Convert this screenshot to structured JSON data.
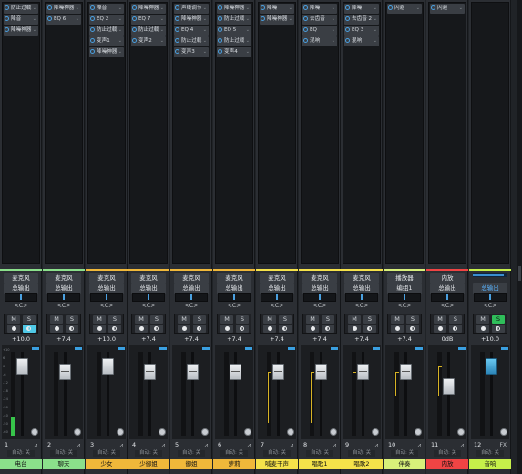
{
  "channels": [
    {
      "num": "1",
      "name": "电台",
      "color": "#8be08b",
      "inserts": [
        "防止过载",
        "降音",
        "降噪神器"
      ],
      "route1": "麦克风",
      "route2": "总输出",
      "pan": "<C>",
      "m": "M",
      "s": "S",
      "mon_on": true,
      "vol": "+10.0",
      "auto": "自动: 关",
      "level": 0.22,
      "fader": 0.92,
      "peak": true
    },
    {
      "num": "2",
      "name": "聊天",
      "color": "#8be08b",
      "inserts": [
        "降噪神器",
        "EQ 6"
      ],
      "route1": "麦克风",
      "route2": "总输出",
      "pan": "<C>",
      "m": "M",
      "s": "S",
      "mon_on": false,
      "vol": "+7.4",
      "auto": "自动: 关",
      "level": 0,
      "fader": 0.86,
      "peak": true
    },
    {
      "num": "3",
      "name": "少女",
      "color": "#f0b83a",
      "inserts": [
        "嗓音",
        "EQ 2",
        "防止过载",
        "变声1",
        "降噪神器"
      ],
      "route1": "麦克风",
      "route2": "总输出",
      "pan": "<C>",
      "m": "M",
      "s": "S",
      "mon_on": false,
      "vol": "+10.0",
      "auto": "自动: 关",
      "level": 0,
      "fader": 0.92,
      "peak": true
    },
    {
      "num": "4",
      "name": "少御姐",
      "color": "#f0b83a",
      "inserts": [
        "降噪神器",
        "EQ 7",
        "防止过载",
        "变声2"
      ],
      "route1": "麦克风",
      "route2": "总输出",
      "pan": "<C>",
      "m": "M",
      "s": "S",
      "mon_on": false,
      "vol": "+7.4",
      "auto": "自动: 关",
      "level": 0,
      "fader": 0.86,
      "peak": true
    },
    {
      "num": "5",
      "name": "御姐",
      "color": "#f0b83a",
      "inserts": [
        "声线调节",
        "降噪神器",
        "EQ 4",
        "防止过载",
        "变声3"
      ],
      "route1": "麦克风",
      "route2": "总输出",
      "pan": "<C>",
      "m": "M",
      "s": "S",
      "mon_on": false,
      "vol": "+7.4",
      "auto": "自动: 关",
      "level": 0,
      "fader": 0.86,
      "peak": true
    },
    {
      "num": "6",
      "name": "萝莉",
      "color": "#f0b83a",
      "inserts": [
        "降噪神器",
        "防止过载",
        "EQ 5",
        "防止过载",
        "变声4"
      ],
      "route1": "麦克风",
      "route2": "总输出",
      "pan": "<C>",
      "m": "M",
      "s": "S",
      "mon_on": false,
      "vol": "+7.4",
      "auto": "自动: 关",
      "level": 0,
      "fader": 0.86,
      "peak": true
    },
    {
      "num": "7",
      "name": "喊麦干声",
      "color": "#f5e24a",
      "inserts": [
        "降噪",
        "降噪神器"
      ],
      "route1": "麦克风",
      "route2": "总输出",
      "pan": "<C>",
      "m": "M",
      "s": "S",
      "mon_on": false,
      "vol": "+7.4",
      "auto": "自动: 关",
      "level": 0,
      "fader": 0.86,
      "peak": true,
      "yline": [
        30,
        86
      ]
    },
    {
      "num": "8",
      "name": "唱歌1",
      "color": "#f5e24a",
      "inserts": [
        "降噪",
        "去齿音",
        "EQ",
        "混响"
      ],
      "route1": "麦克风",
      "route2": "总输出",
      "pan": "<C>",
      "m": "M",
      "s": "S",
      "mon_on": false,
      "vol": "+7.4",
      "auto": "自动: 关",
      "level": 0,
      "fader": 0.86,
      "peak": true,
      "yline": [
        30,
        86
      ]
    },
    {
      "num": "9",
      "name": "唱歌2",
      "color": "#f5e24a",
      "inserts": [
        "降噪",
        "去齿音 2",
        "EQ 3",
        "混响"
      ],
      "route1": "麦克风",
      "route2": "总输出",
      "pan": "<C>",
      "m": "M",
      "s": "S",
      "mon_on": false,
      "vol": "+7.4",
      "auto": "自动: 关",
      "level": 0,
      "fader": 0.86,
      "peak": true,
      "yline": [
        30,
        86
      ]
    },
    {
      "num": "10",
      "name": "伴奏",
      "color": "#d8f07a",
      "inserts": [
        "闪避"
      ],
      "route1": "播放器",
      "route2": "编组1",
      "pan": "<C>",
      "m": "M",
      "s": "S",
      "mon_on": false,
      "vol": "+7.4",
      "auto": "自动: 关",
      "level": 0,
      "fader": 0.86,
      "peak": true,
      "yline": [
        30,
        56
      ]
    },
    {
      "num": "11",
      "name": "内放",
      "color": "#f04444",
      "inserts": [
        "闪避"
      ],
      "route1": "内放",
      "route2": "总输出",
      "pan": "<C>",
      "m": "M",
      "s": "S",
      "mon_on": false,
      "vol": "0dB",
      "auto": "自动: 关",
      "level": 0,
      "fader": 0.68,
      "peak": true,
      "yline": [
        24,
        56
      ]
    },
    {
      "num": "12",
      "name": "音响",
      "color": "#c6f04a",
      "inserts": [],
      "route1": "",
      "route2": "总输出",
      "pan": "<C>",
      "m": "M",
      "s": "S",
      "mon_on": false,
      "s_on": true,
      "vol": "+10.0",
      "auto": "自动: 关",
      "level": 0,
      "fader": 0.92,
      "peak": true,
      "fx": "FX",
      "blue": true
    }
  ],
  "scale": [
    "+10",
    "6",
    "0",
    "-6",
    "-12",
    "-18",
    "-24",
    "-30",
    "-40",
    "-50",
    "-60"
  ],
  "icons": {
    "power": "power-icon",
    "dropdown": "dropdown-arrow-icon",
    "record": "record-icon",
    "monitor": "monitor-icon",
    "bars": "edit-bars-icon"
  }
}
